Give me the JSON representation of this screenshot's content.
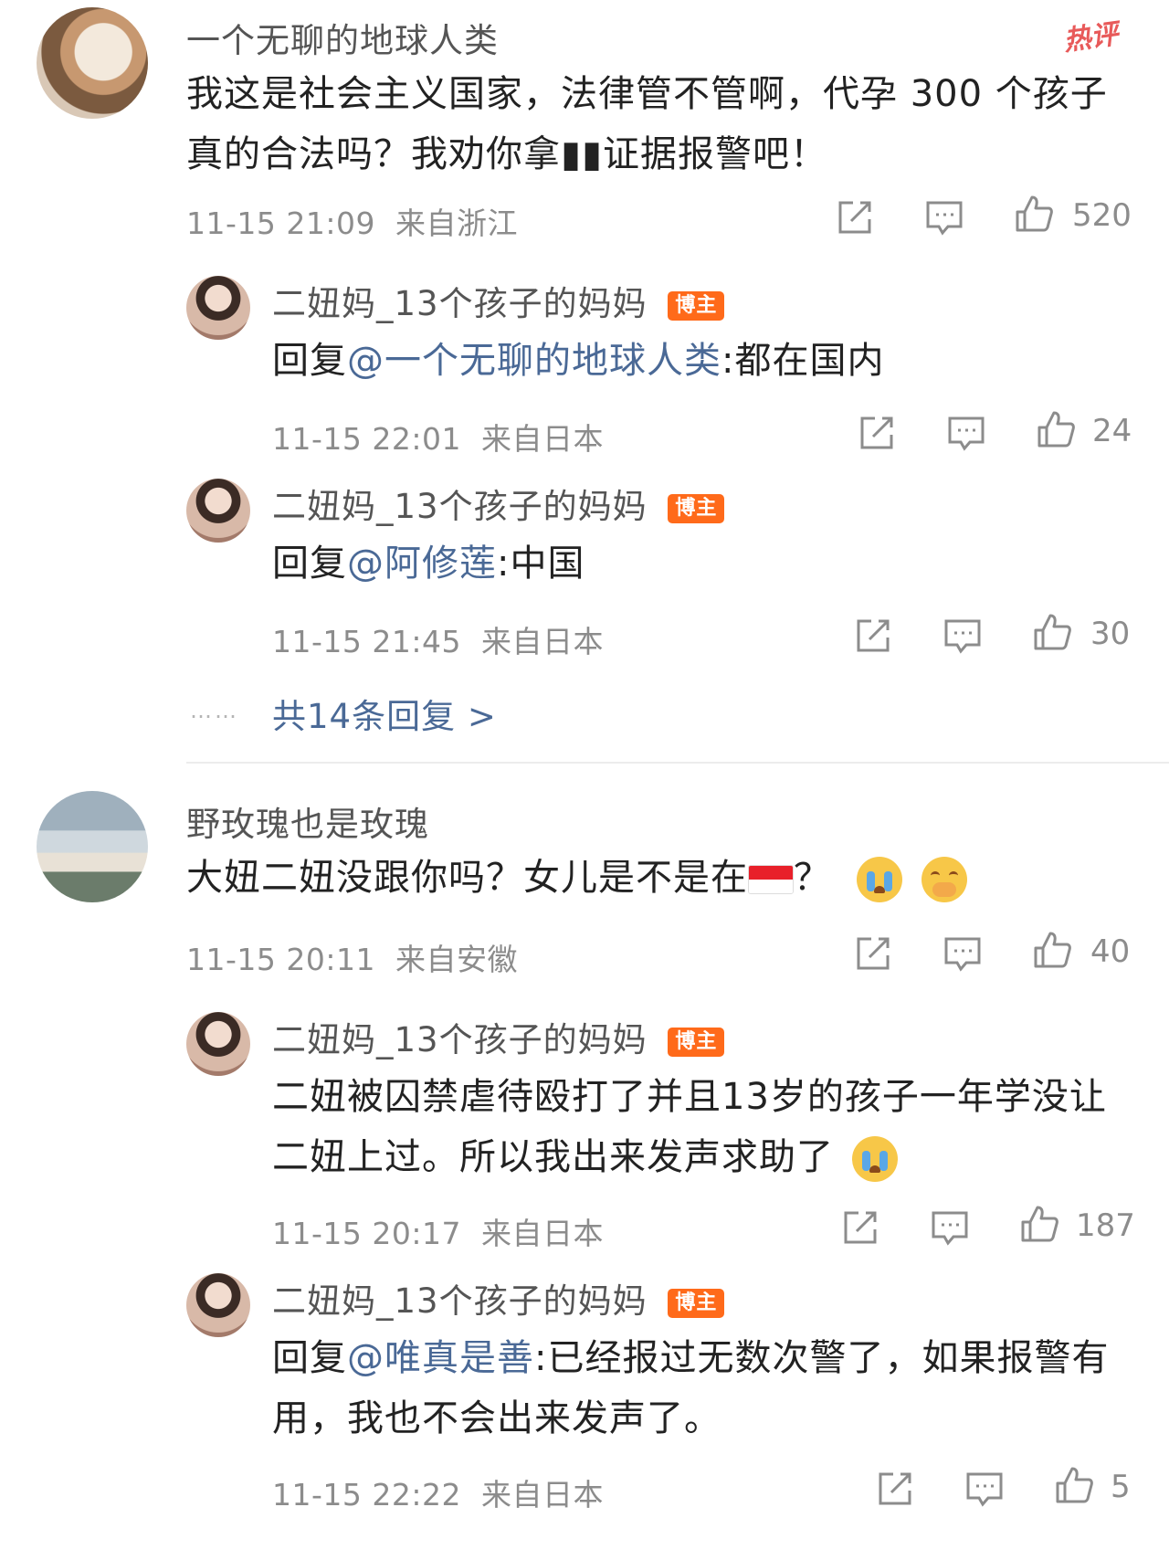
{
  "hot_label": "热评",
  "comment1": {
    "username": "一个无聊的地球人类",
    "text": "我这是社会主义国家，法律管不管啊，代孕 300 个孩子真的合法吗？我劝你拿▮▮证据报警吧！",
    "time": "11-15 21:09",
    "location": "来自浙江",
    "likes": "520",
    "replies": [
      {
        "username": "二妞妈_13个孩子的妈妈",
        "badge": "博主",
        "prefix": "回复",
        "mention": "@一个无聊的地球人类",
        "text": ":都在国内",
        "time": "11-15 22:01",
        "location": "来自日本",
        "likes": "24"
      },
      {
        "username": "二妞妈_13个孩子的妈妈",
        "badge": "博主",
        "prefix": "回复",
        "mention": "@阿修莲",
        "text": ":中国",
        "time": "11-15 21:45",
        "location": "来自日本",
        "likes": "30"
      }
    ],
    "more_dots": "……",
    "more_replies": "共14条回复 >"
  },
  "comment2": {
    "username": "野玫瑰也是玫瑰",
    "text_a": "大妞二妞没跟你吗？女儿是不是在",
    "text_b": "？",
    "time": "11-15 20:11",
    "location": "来自安徽",
    "likes": "40",
    "replies": [
      {
        "username": "二妞妈_13个孩子的妈妈",
        "badge": "博主",
        "text": "二妞被囚禁虐待殴打了并且13岁的孩子一年学没让二妞上过。所以我出来发声求助了",
        "time": "11-15 20:17",
        "location": "来自日本",
        "likes": "187"
      },
      {
        "username": "二妞妈_13个孩子的妈妈",
        "badge": "博主",
        "prefix": "回复",
        "mention": "@唯真是善",
        "text": ":已经报过无数次警了，如果报警有用，我也不会出来发声了。",
        "time": "11-15 22:22",
        "location": "来自日本",
        "likes": "5"
      }
    ]
  },
  "icons": {
    "share": "share-icon",
    "comment": "comment-icon",
    "like": "thumbs-up-icon",
    "crying": "crying-face-emoji",
    "covering_mouth": "hand-over-mouth-emoji",
    "flag": "singapore-flag-emoji"
  },
  "colors": {
    "mention": "#4a6996",
    "badge": "#ff6a1a",
    "hot": "#e85a5a",
    "meta": "#8c8c8c"
  }
}
